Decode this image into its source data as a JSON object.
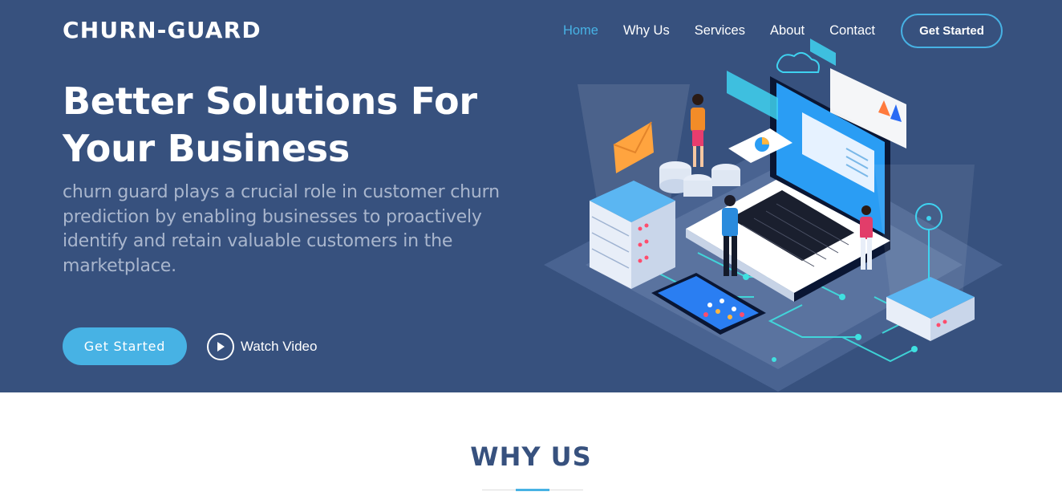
{
  "brand": {
    "logo": "CHURN-GUARD"
  },
  "nav": {
    "items": [
      {
        "label": "Home",
        "active": true
      },
      {
        "label": "Why Us"
      },
      {
        "label": "Services"
      },
      {
        "label": "About"
      },
      {
        "label": "Contact"
      }
    ],
    "cta": "Get Started"
  },
  "hero": {
    "headline": "Better Solutions For Your Business",
    "subtitle": "churn guard plays a crucial role in customer churn prediction by enabling businesses to proactively identify and retain valuable customers in the marketplace.",
    "primary_button": "Get Started",
    "video_button": "Watch Video",
    "play_icon": "play-icon",
    "illustration": "isometric-business-technology-illustration"
  },
  "why_us": {
    "title": "WHY US"
  },
  "colors": {
    "hero_background": "#37517e",
    "accent": "#47b2e4",
    "white": "#ffffff",
    "subtitle_text": "#a9b6cd",
    "section_title": "#37517e"
  }
}
